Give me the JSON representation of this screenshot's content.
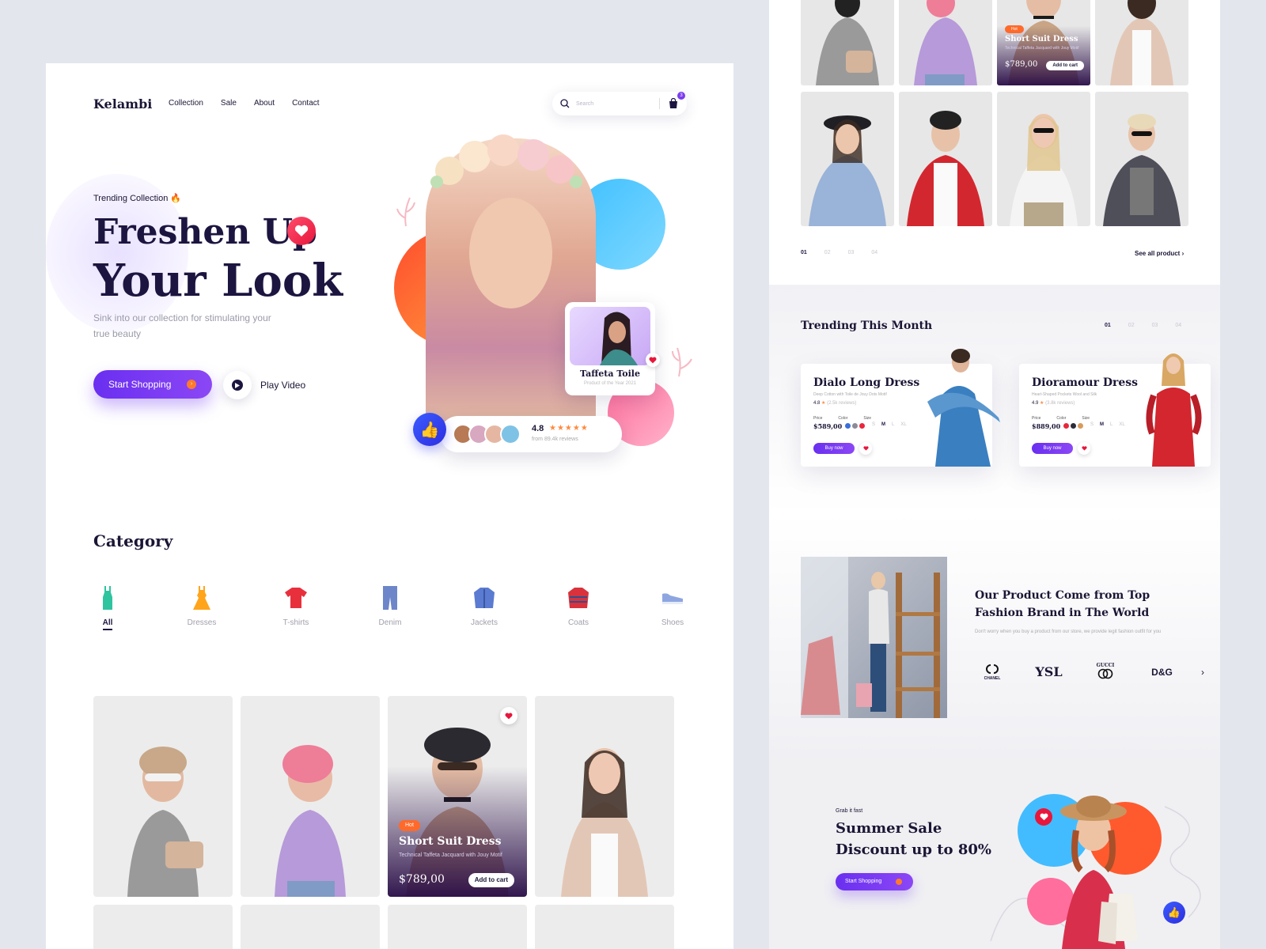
{
  "site": {
    "logo": "Kelambi",
    "nav": [
      "Collection",
      "Sale",
      "About",
      "Contact"
    ],
    "search_placeholder": "Search",
    "cart_count": "3"
  },
  "hero": {
    "tag": "Trending Collection 🔥",
    "title_line1": "Freshen Up",
    "title_line2": "Your Look",
    "subtitle": "Sink into our collection for stimulating your true beauty",
    "start_label": "Start Shopping",
    "play_label": "Play Video",
    "product_name": "Taffeta Toile",
    "product_sub": "Product of the Year 2021",
    "rating": "4.8",
    "stars": 5,
    "reviews": "from 89.4k reviews"
  },
  "category": {
    "title": "Category",
    "items": [
      "All",
      "Dresses",
      "T-shirts",
      "Denim",
      "Jackets",
      "Coats",
      "Shoes"
    ],
    "active": "All"
  },
  "featured_product": {
    "badge": "Hot",
    "name": "Short Suit Dress",
    "desc": "Technical Taffeta Jacquard with Jouy Motif",
    "price": "$789,00",
    "cart_label": "Add to cart"
  },
  "gallery": {
    "pages": [
      "01",
      "02",
      "03",
      "04"
    ],
    "active_page": "01",
    "see_all": "See all product"
  },
  "trending": {
    "title": "Trending This Month",
    "pages": [
      "01",
      "02",
      "03",
      "04"
    ],
    "active_page": "01",
    "labels": {
      "price": "Price",
      "color": "Color",
      "size": "Size"
    },
    "sizes": [
      "S",
      "M",
      "L",
      "XL"
    ],
    "buy_label": "Buy now",
    "items": [
      {
        "name": "Dialo Long Dress",
        "desc": "Deep Cotton with Toile de Jouy Dots Motif",
        "rating": "4.8",
        "reviews": "(2.5k reviews)",
        "price": "$589,00",
        "colors": [
          "#3b6fd9",
          "#8b8b97",
          "#e8273d"
        ],
        "active_size": "M"
      },
      {
        "name": "Dioramour Dress",
        "desc": "Heart-Shaped Pockets Wool and Silk",
        "rating": "4.9",
        "reviews": "(3.8k reviews)",
        "price": "$889,00",
        "colors": [
          "#e8273d",
          "#2d2d3a",
          "#d99a5b"
        ],
        "active_size": "M"
      }
    ]
  },
  "brands": {
    "title": "Our Product Come from Top Fashion Brand in The World",
    "subtitle": "Don't worry when you buy a product from our store, we provide legit fashion outfit for you",
    "list": [
      "CHANEL",
      "YSL",
      "GUCCI",
      "D&G"
    ]
  },
  "summer": {
    "tag": "Grab it fast",
    "title_line1": "Summer Sale",
    "title_line2": "Discount up to 80%",
    "button": "Start Shopping"
  },
  "colors": {
    "accent": "#7b3cf0",
    "heart": "#e8163b",
    "orange": "#ff6a2b",
    "dark": "#1c1540"
  }
}
